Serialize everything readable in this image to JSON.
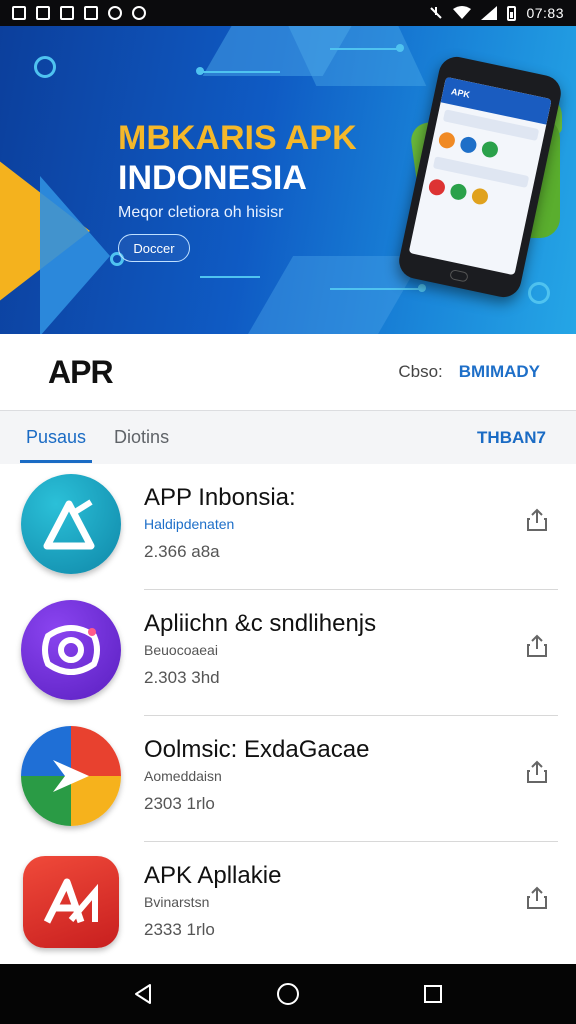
{
  "status_bar": {
    "time": "07:83",
    "icons": [
      "image-icon",
      "image-icon",
      "image-icon",
      "image-icon",
      "shield-icon",
      "android-icon"
    ],
    "right_icons": [
      "mute-icon",
      "wifi-icon",
      "signal-icon",
      "battery-icon"
    ]
  },
  "banner": {
    "title_line1": "MBKARIS APK",
    "title_line2": "INDONESIA",
    "subtitle": "Meqor cletiora oh hisisr",
    "button_label": "Doccer",
    "phone_header": "APK",
    "colors": {
      "yellow": "#f4b21e",
      "blue": "#0f5bc4",
      "android_green": "#5aae2e"
    }
  },
  "appbar": {
    "logo": "APR",
    "label": "Cbso:",
    "link": "BMIMADY"
  },
  "tabs": {
    "items": [
      "Pusaus",
      "Diotins"
    ],
    "active_index": 0,
    "right_label": "THBAN7"
  },
  "apps": [
    {
      "title": "APP Inbonsia:",
      "subtitle": "Haldipdenaten",
      "meta": "2.366 a8a",
      "icon": "triangle-a-icon",
      "icon_color": "#1496b6"
    },
    {
      "title": "Apliichn &c sndlihenjs",
      "subtitle": "Beuocoaeai",
      "meta": "2.303 3hd",
      "icon": "camera-icon",
      "icon_color": "#6a2bd1"
    },
    {
      "title": "Oolmsic: ExdaGacae",
      "subtitle": "Aomeddaisn",
      "meta": "2303 1rlo",
      "icon": "colorful-arrow-icon",
      "icon_color": "#1f6fd6"
    },
    {
      "title": "APK Apllakie",
      "subtitle": "Bvinarstsn",
      "meta": "2333 1rlo",
      "icon": "letter-a-icon",
      "icon_color": "#e02a2a"
    }
  ],
  "navbar": {
    "buttons": [
      "back-icon",
      "home-icon",
      "recents-icon"
    ]
  }
}
